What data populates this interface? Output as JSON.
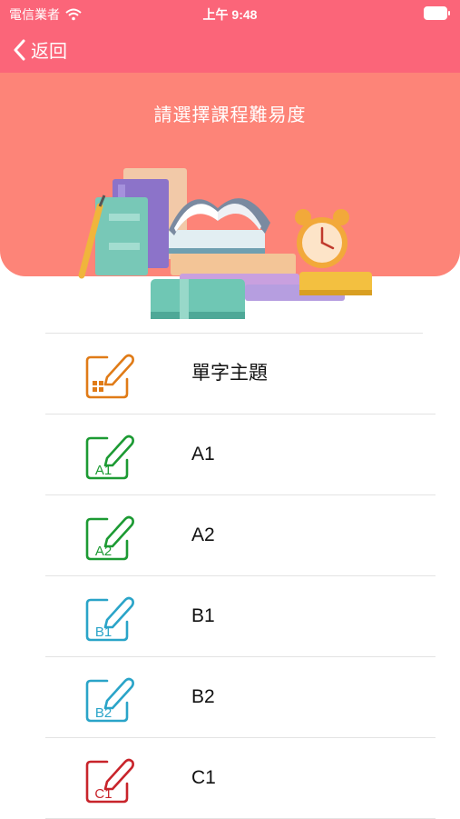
{
  "status_bar": {
    "carrier": "電信業者",
    "time": "上午 9:48"
  },
  "nav": {
    "back_label": "返回"
  },
  "banner": {
    "title": "請選擇課程難易度"
  },
  "levels": [
    {
      "label": "單字主題",
      "badge": "",
      "icon": "vocabulary-topic-icon",
      "color": "#e07b17"
    },
    {
      "label": "A1",
      "badge": "A1",
      "icon": "level-edit-icon",
      "color": "#1c9a33"
    },
    {
      "label": "A2",
      "badge": "A2",
      "icon": "level-edit-icon",
      "color": "#1c9a33"
    },
    {
      "label": "B1",
      "badge": "B1",
      "icon": "level-edit-icon",
      "color": "#2aa4c8"
    },
    {
      "label": "B2",
      "badge": "B2",
      "icon": "level-edit-icon",
      "color": "#2aa4c8"
    },
    {
      "label": "C1",
      "badge": "C1",
      "icon": "level-edit-icon",
      "color": "#c8242b"
    }
  ],
  "colors": {
    "header": "#fb6579",
    "banner": "#fd8478"
  }
}
